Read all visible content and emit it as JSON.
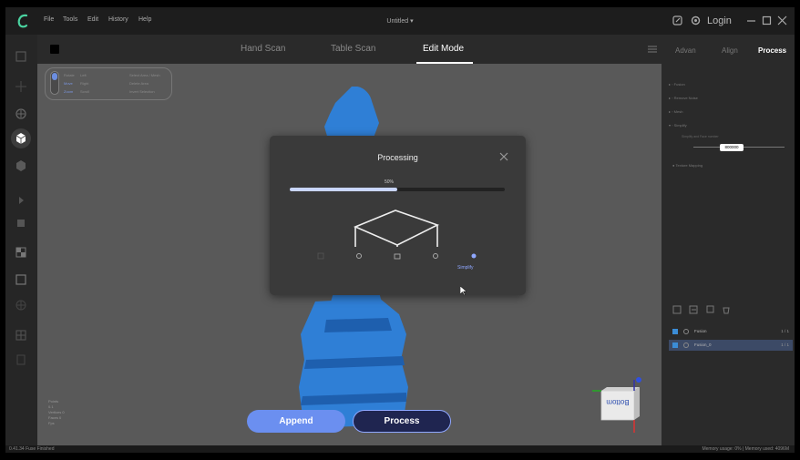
{
  "menu": [
    "File",
    "Tools",
    "Edit",
    "History",
    "Help"
  ],
  "title": "Untitled",
  "title_chevron": "▾",
  "login_label": "Login",
  "mode_tabs": {
    "hand": "Hand Scan",
    "table": "Table Scan",
    "edit": "Edit Mode"
  },
  "right_tabs": {
    "advan": "Advan",
    "align": "Align",
    "process": "Process"
  },
  "process_ops": [
    "Fusion",
    "Remove Noise",
    "Mesh",
    "Simplify"
  ],
  "simplify_option_label": "Simplify and Face number",
  "simplify_value": "800000",
  "auto_label": "Texture Mapping",
  "layers": [
    {
      "name": "Fusion",
      "count": "1 / 1",
      "active": false
    },
    {
      "name": "Fusion_0",
      "count": "1 / 1",
      "active": true
    }
  ],
  "hint": {
    "rotate_label": "Rotate",
    "rotate_key": "Left",
    "pan_label": "Move",
    "pan_key": "Right",
    "zoom_label": "Zoom",
    "zoom_key": "Scroll",
    "extra1": "Select Area / Mesh",
    "extra2": "Delete Area",
    "extra3": "Invert Selection"
  },
  "viewport_info": [
    "Points",
    "0.1",
    "Vertices 0",
    "Faces 0",
    "Fps"
  ],
  "axis_face_label": "Bottom",
  "actions": {
    "append": "Append",
    "process": "Process"
  },
  "modal": {
    "title": "Processing",
    "progress_label": "50%",
    "progress": 0.5,
    "current_step": "Simplify"
  },
  "status": {
    "left": "0.41.34 Fuse Finished",
    "right": "Memory usage: 0% | Memory used: 4096M"
  },
  "colors": {
    "accent": "#6b8ff0",
    "mesh": "#2f7fd6",
    "viewport": "#595959",
    "panel": "#2a2a2a"
  }
}
